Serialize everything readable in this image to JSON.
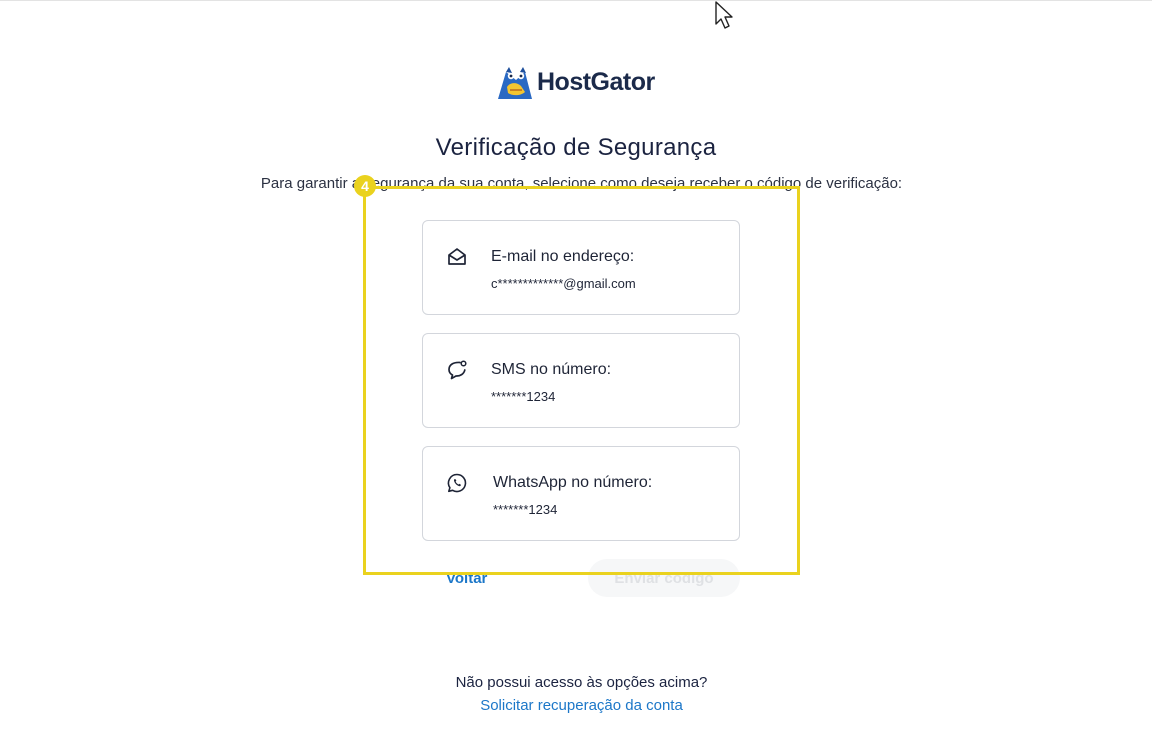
{
  "brand": {
    "name": "HostGator"
  },
  "page": {
    "title": "Verificação de Segurança",
    "subtitle": "Para garantir a segurança da sua conta, selecione como deseja receber o código de verificação:"
  },
  "options": [
    {
      "label": "E-mail no endereço:",
      "value": "c*************@gmail.com",
      "icon": "envelope-icon"
    },
    {
      "label": "SMS no número:",
      "value": "*******1234",
      "icon": "chat-bubble-icon"
    },
    {
      "label": "WhatsApp no número:",
      "value": "*******1234",
      "icon": "whatsapp-icon"
    }
  ],
  "actions": {
    "back": "Voltar",
    "send": "Enviar código"
  },
  "annotation": {
    "step": "4",
    "color": "#ead21e"
  },
  "footer": {
    "question": "Não possui acesso às opções acima?",
    "link": "Solicitar recuperação da conta"
  },
  "colors": {
    "link": "#1c77c8",
    "title": "#1b2340",
    "disabled_text": "#dfe1e4"
  }
}
